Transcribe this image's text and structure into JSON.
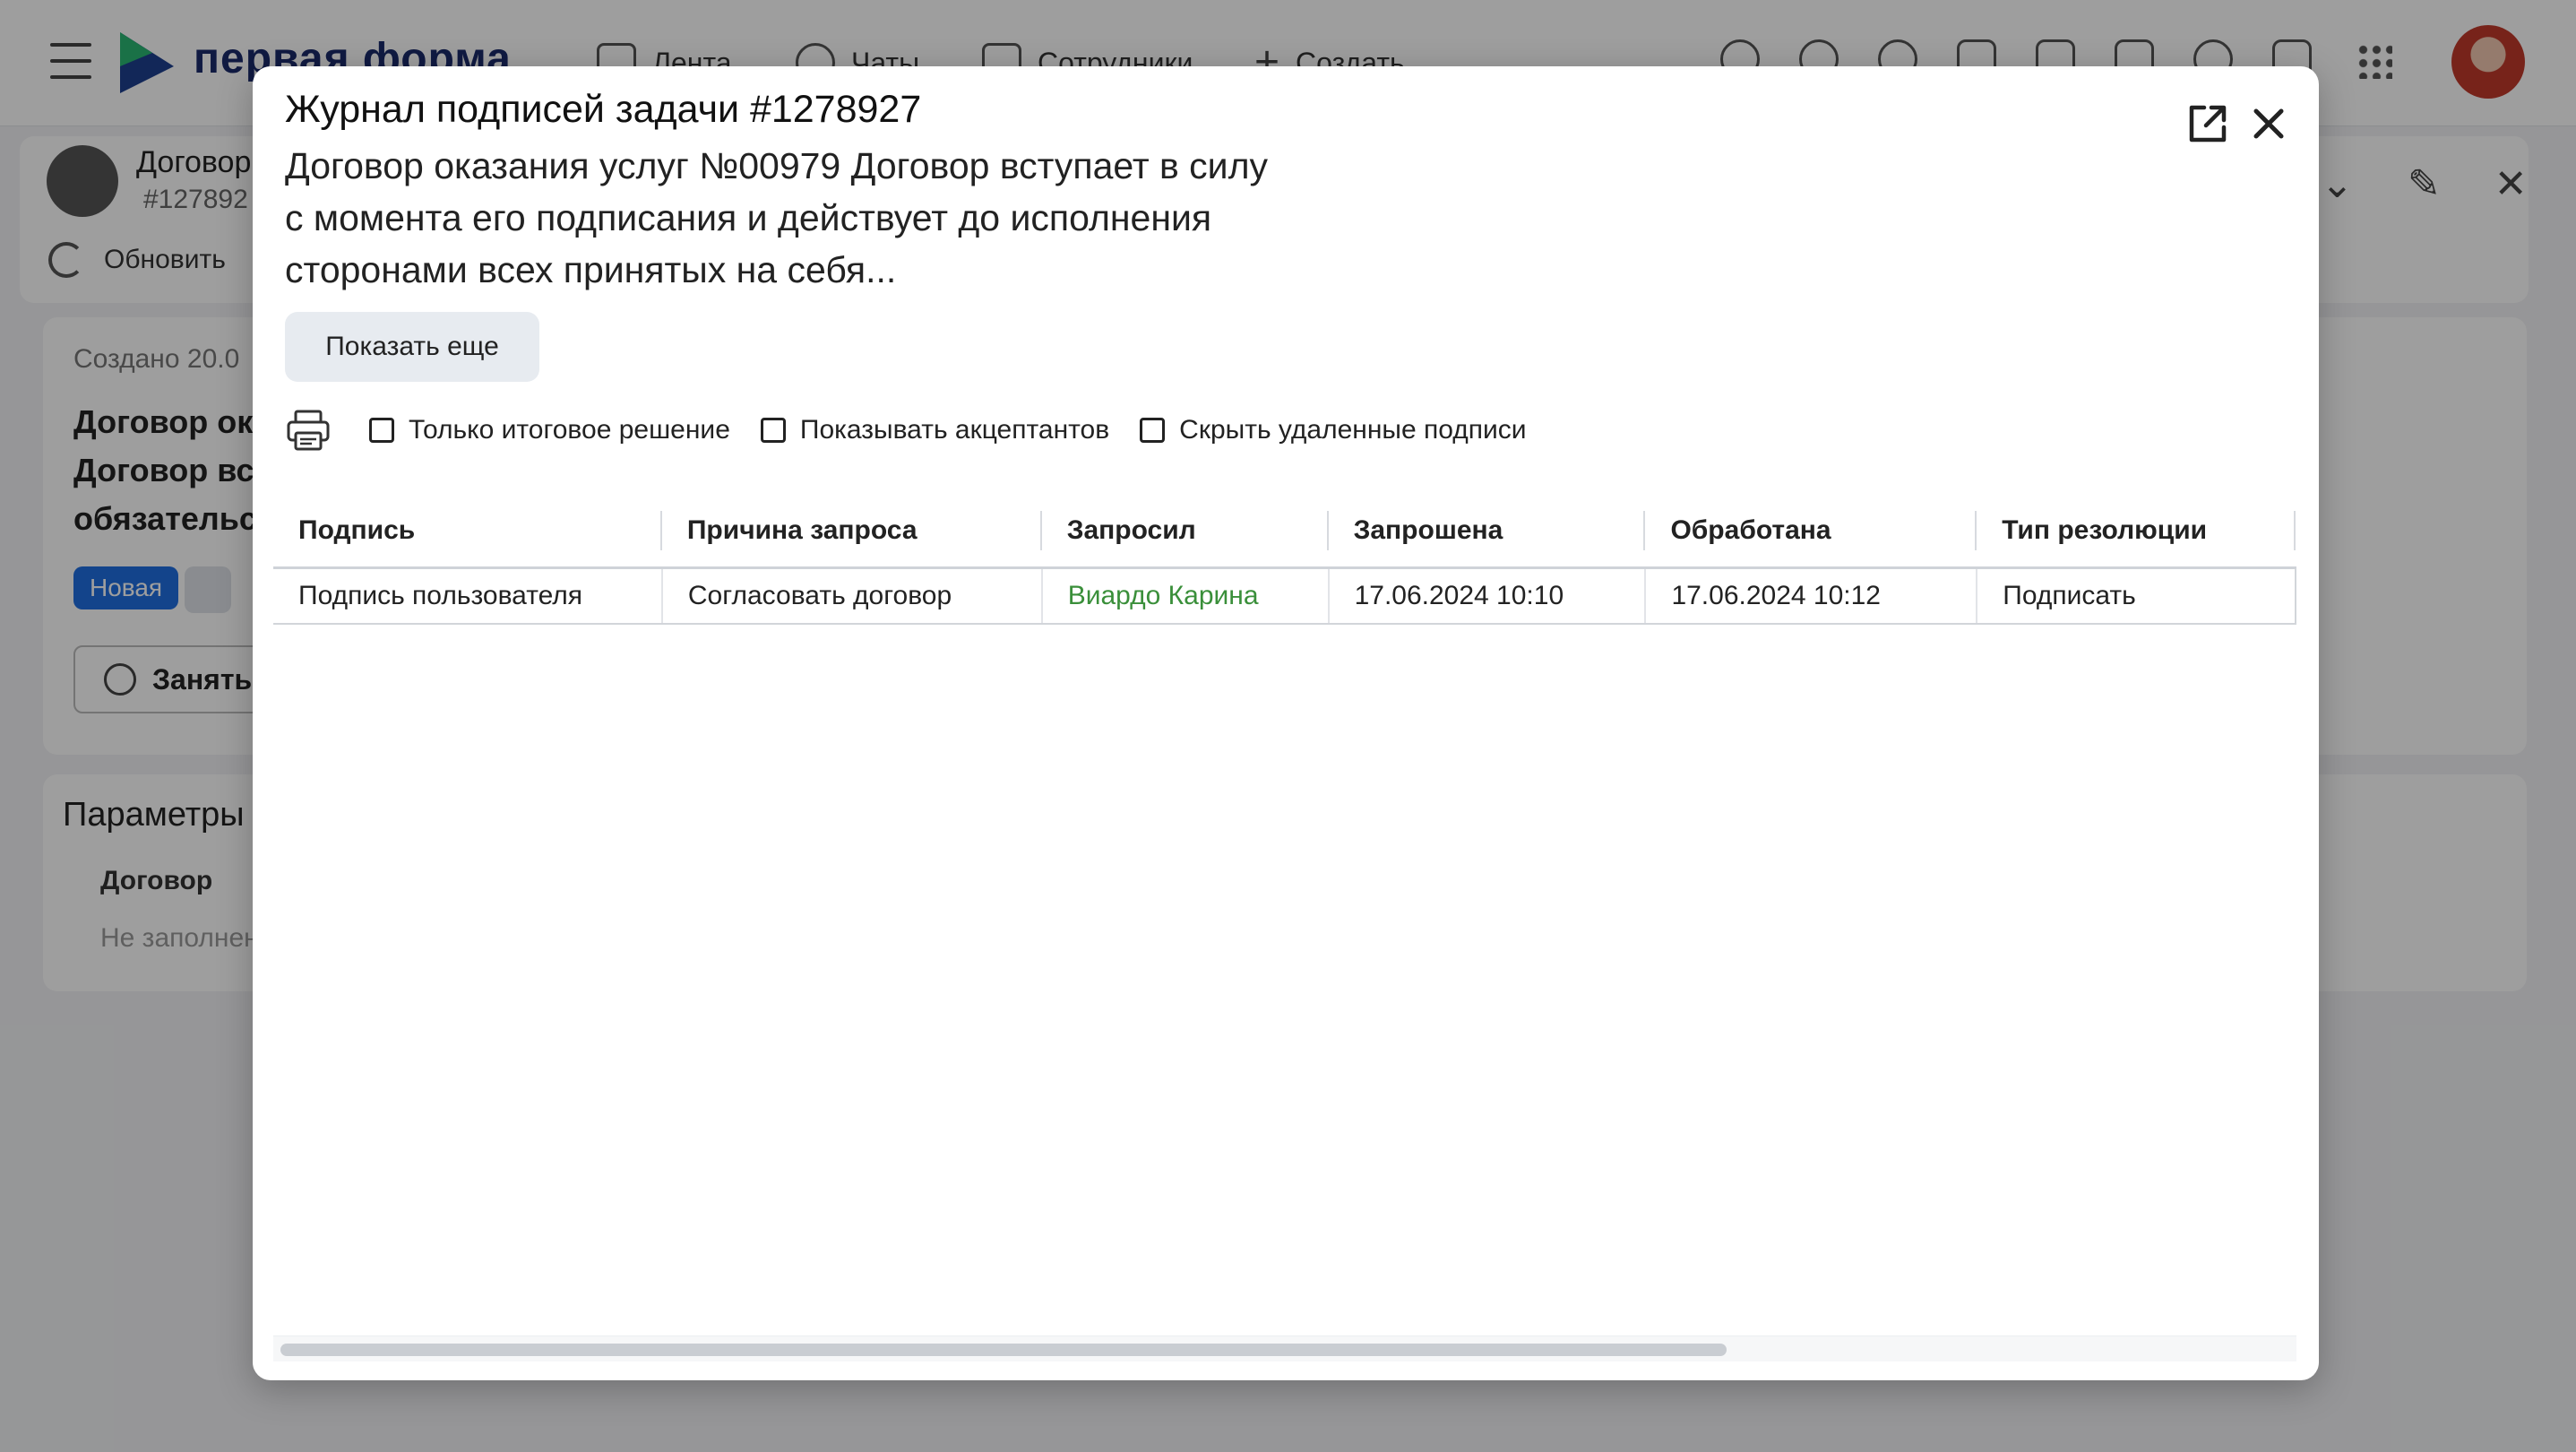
{
  "app": {
    "logo_text": "первая форма",
    "nav": {
      "feed": "Лента",
      "chats": "Чаты",
      "staff": "Сотрудники",
      "create": "Создать"
    }
  },
  "background_task": {
    "title": "Договор",
    "number": "#127892",
    "refresh_label": "Обновить",
    "created": "Создано 20.0",
    "title_lines": [
      "Договор ока",
      "Договор вст",
      "обязательст"
    ],
    "status": "Новая",
    "take_label": "Заняться",
    "params_title": "Параметры",
    "params_field_label": "Договор",
    "params_field_value": "Не заполнен"
  },
  "modal": {
    "title": "Журнал подписей задачи #1278927",
    "description": "Договор оказания услуг №00979 Договор вступает в силу с момента его подписания и действует до исполнения сторонами всех принятых на себя...",
    "show_more": "Показать еще",
    "filters": {
      "final_only": "Только итоговое решение",
      "show_acceptants": "Показывать акцептантов",
      "hide_deleted": "Скрыть удаленные подписи"
    },
    "table": {
      "columns": [
        "Подпись",
        "Причина запроса",
        "Запросил",
        "Запрошена",
        "Обработана",
        "Тип резолюции"
      ],
      "rows": [
        {
          "signature": "Подпись пользователя",
          "reason": "Согласовать договор",
          "requested_by": "Виардо Карина",
          "requested_at": "17.06.2024 10:10",
          "processed_at": "17.06.2024 10:12",
          "resolution": "Подписать"
        }
      ]
    }
  },
  "colors": {
    "accent_link": "#3a8f3a",
    "status_new": "#1f6fe0",
    "overlay": "rgba(0,0,0,0.38)"
  }
}
